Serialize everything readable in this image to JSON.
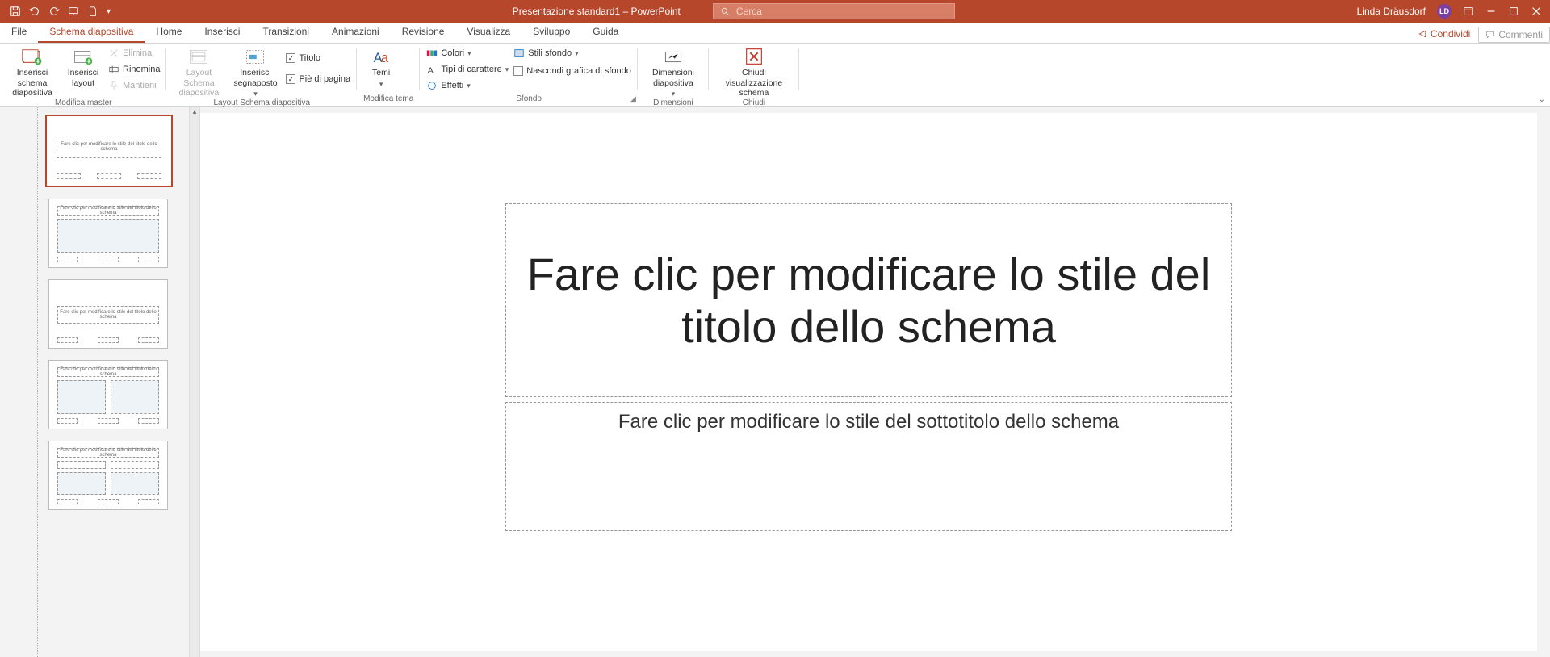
{
  "app": {
    "doc_title": "Presentazione standard1",
    "app_name": "PowerPoint",
    "title_sep": "  –  ",
    "search_placeholder": "Cerca",
    "user_name": "Linda Dräusdorf",
    "user_initials": "LD"
  },
  "tabs": {
    "file": "File",
    "slide_master": "Schema diapositiva",
    "home": "Home",
    "insert": "Inserisci",
    "transitions": "Transizioni",
    "animations": "Animazioni",
    "review": "Revisione",
    "view": "Visualizza",
    "developer": "Sviluppo",
    "help": "Guida",
    "share": "Condividi",
    "comments": "Commenti"
  },
  "ribbon": {
    "edit_master": {
      "insert_master": "Inserisci schema diapositiva",
      "insert_layout": "Inserisci layout",
      "delete": "Elimina",
      "rename": "Rinomina",
      "preserve": "Mantieni",
      "label": "Modifica master"
    },
    "master_layout": {
      "master_layout": "Layout Schema diapositiva",
      "insert_placeholder": "Inserisci segnaposto",
      "title": "Titolo",
      "footer": "Piè di pagina",
      "label": "Layout Schema diapositiva"
    },
    "edit_theme": {
      "themes": "Temi",
      "label": "Modifica tema"
    },
    "background": {
      "colors": "Colori",
      "fonts": "Tipi di carattere",
      "effects": "Effetti",
      "bg_styles": "Stili sfondo",
      "hide_bg": "Nascondi grafica di sfondo",
      "label": "Sfondo"
    },
    "size": {
      "slide_size": "Dimensioni diapositiva",
      "label": "Dimensioni"
    },
    "close": {
      "close_master": "Chiudi visualizzazione schema",
      "label": "Chiudi"
    }
  },
  "slide": {
    "title_text": "Fare clic per modificare lo stile del titolo dello schema",
    "subtitle_text": "Fare clic per modificare lo stile del sottotitolo dello schema"
  },
  "thumbs": {
    "master_text": "Fare clic per modificare lo stile del titolo dello schema",
    "layout_text": "Fare clic per modificare lo stile del titolo dello schema"
  }
}
